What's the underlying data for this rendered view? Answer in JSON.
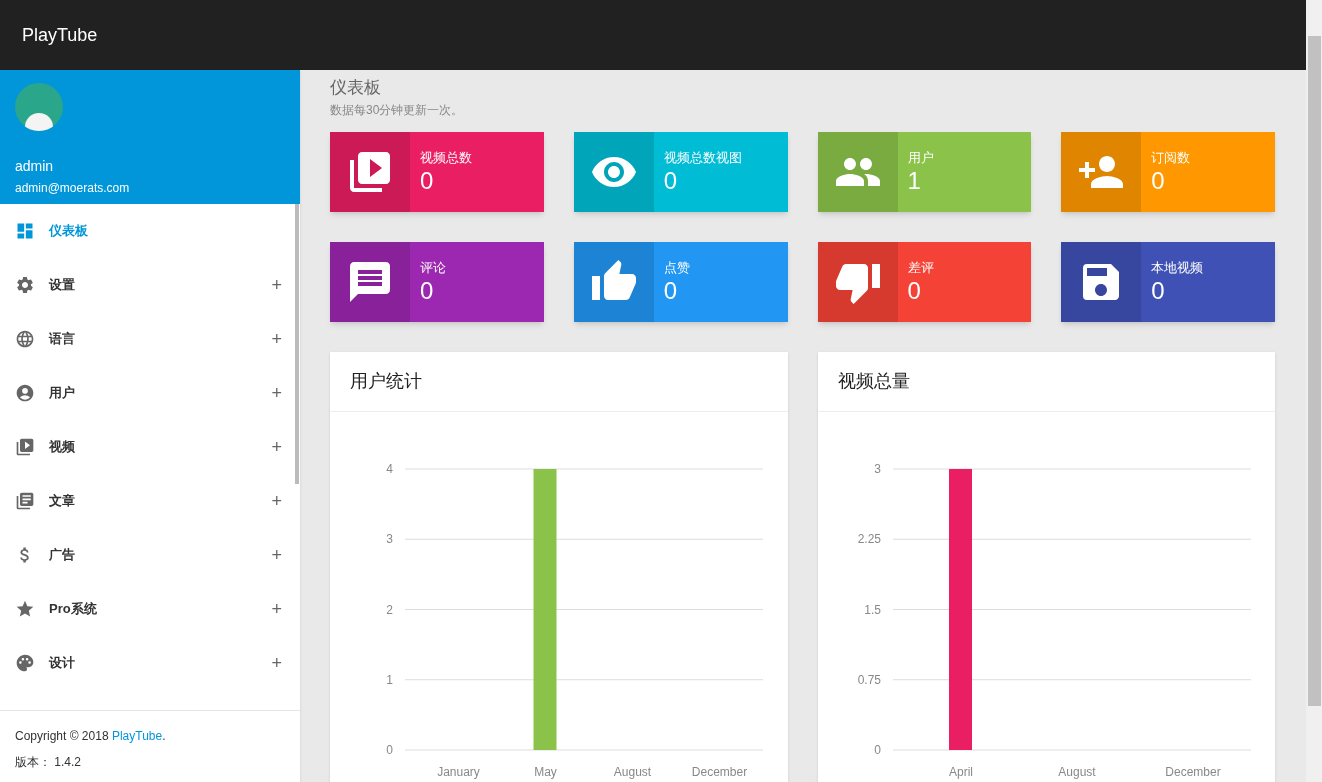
{
  "app": {
    "title": "PlayTube"
  },
  "profile": {
    "name": "admin",
    "email": "admin@moerats.com"
  },
  "menu": [
    {
      "label": "仪表板",
      "selected": true
    },
    {
      "label": "设置",
      "selected": false,
      "toggle": "+"
    },
    {
      "label": "语言",
      "selected": false,
      "toggle": "+"
    },
    {
      "label": "用户",
      "selected": false,
      "toggle": "+"
    },
    {
      "label": "视频",
      "selected": false,
      "toggle": "+"
    },
    {
      "label": "文章",
      "selected": false,
      "toggle": "+"
    },
    {
      "label": "广告",
      "selected": false,
      "toggle": "+"
    },
    {
      "label": "Pro系统",
      "selected": false,
      "toggle": "+"
    },
    {
      "label": "设计",
      "selected": false,
      "toggle": "+"
    }
  ],
  "footer": {
    "copyright": "Copyright © 2018",
    "link": "PlayTube",
    "link_suffix": ".",
    "version_label": "版本：",
    "version": "1.4.2"
  },
  "page": {
    "title": "仪表板",
    "subtitle": "数据每30分钟更新一次。"
  },
  "stats": [
    {
      "label": "视频总数",
      "value": "0",
      "color": "#e91e63"
    },
    {
      "label": "视频总数视图",
      "value": "0",
      "color": "#00bcd4"
    },
    {
      "label": "用户",
      "value": "1",
      "color": "#8bc34a"
    },
    {
      "label": "订阅数",
      "value": "0",
      "color": "#ff9800"
    },
    {
      "label": "评论",
      "value": "0",
      "color": "#9c27b0"
    },
    {
      "label": "点赞",
      "value": "0",
      "color": "#2196f3"
    },
    {
      "label": "差评",
      "value": "0",
      "color": "#f44336"
    },
    {
      "label": "本地视频",
      "value": "0",
      "color": "#3f51b5"
    }
  ],
  "charts": [
    {
      "title": "用户统计",
      "chart_data": {
        "type": "bar",
        "categories": [
          "January",
          "May",
          "August",
          "December"
        ],
        "grid": true,
        "series": [
          {
            "color": "#8bc34a",
            "values": [
              null,
              4,
              null,
              null
            ]
          }
        ],
        "ylim": [
          0,
          4
        ],
        "yticks": [
          0,
          1,
          2,
          3,
          4
        ]
      }
    },
    {
      "title": "视频总量",
      "chart_data": {
        "type": "bar",
        "categories": [
          "April",
          "August",
          "December"
        ],
        "grid": true,
        "series": [
          {
            "color": "#e91e63",
            "values": [
              3,
              null,
              null
            ]
          }
        ],
        "ylim": [
          0,
          3
        ],
        "yticks": [
          0,
          {
            "value": 0.75,
            "label": "0.75"
          },
          {
            "value": 1.5,
            "label": "1.5"
          },
          {
            "value": 2.25,
            "label": "2.25"
          },
          3
        ]
      }
    }
  ]
}
